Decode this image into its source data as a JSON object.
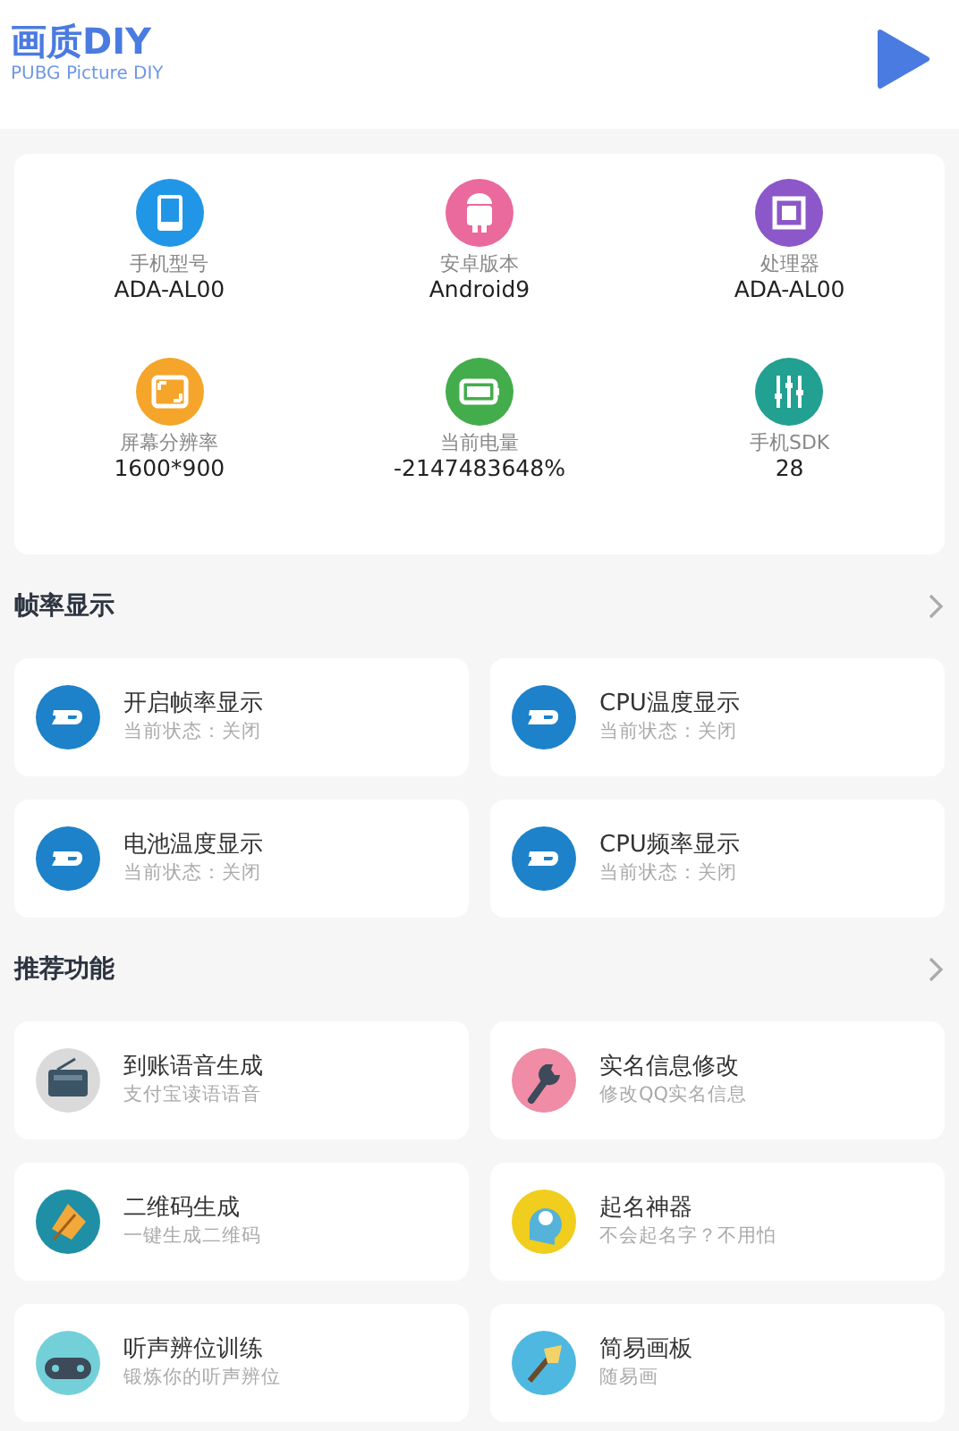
{
  "header": {
    "title": "画质DIY",
    "subtitle": "PUBG Picture DIY"
  },
  "device_info": [
    {
      "label": "手机型号",
      "value": "ADA-AL00"
    },
    {
      "label": "安卓版本",
      "value": "Android9"
    },
    {
      "label": "处理器",
      "value": "ADA-AL00"
    },
    {
      "label": "屏幕分辨率",
      "value": "1600*900"
    },
    {
      "label": "当前电量",
      "value": "-2147483648%"
    },
    {
      "label": "手机SDK",
      "value": "28"
    }
  ],
  "sections": [
    {
      "title": "帧率显示",
      "items": [
        {
          "title": "开启帧率显示",
          "subtitle": "当前状态：关闭"
        },
        {
          "title": "CPU温度显示",
          "subtitle": "当前状态：关闭"
        },
        {
          "title": "电池温度显示",
          "subtitle": "当前状态：关闭"
        },
        {
          "title": "CPU频率显示",
          "subtitle": "当前状态：关闭"
        }
      ]
    },
    {
      "title": "推荐功能",
      "items": [
        {
          "title": "到账语音生成",
          "subtitle": "支付宝读语语音"
        },
        {
          "title": "实名信息修改",
          "subtitle": "修改QQ实名信息"
        },
        {
          "title": "二维码生成",
          "subtitle": "一键生成二维码"
        },
        {
          "title": "起名神器",
          "subtitle": "不会起名字？不用怕"
        },
        {
          "title": "听声辨位训练",
          "subtitle": "锻炼你的听声辨位"
        },
        {
          "title": "简易画板",
          "subtitle": "随易画"
        }
      ]
    }
  ]
}
